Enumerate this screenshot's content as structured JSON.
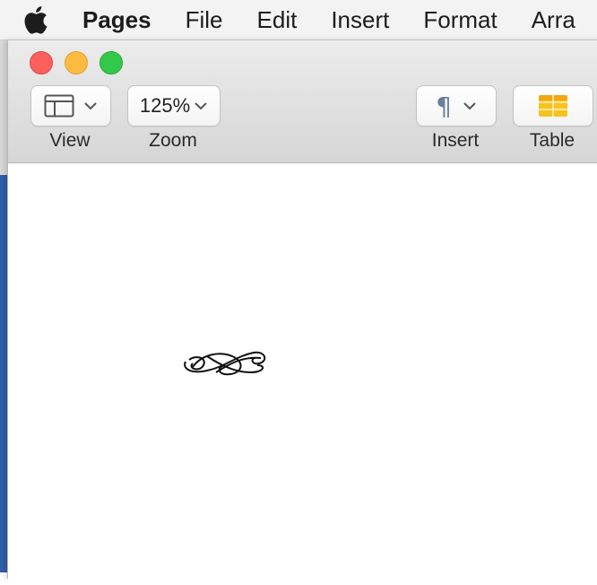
{
  "menubar": {
    "apple_icon": "apple-logo",
    "items": [
      "Pages",
      "File",
      "Edit",
      "Insert",
      "Format",
      "Arra"
    ]
  },
  "toolbar": {
    "view": {
      "label": "View",
      "icon": "sidebar-layout-icon"
    },
    "zoom": {
      "label": "Zoom",
      "value": "125%"
    },
    "insert": {
      "label": "Insert",
      "icon": "pilcrow-icon",
      "glyph": "¶"
    },
    "table": {
      "label": "Table",
      "icon": "table-icon"
    }
  },
  "colors": {
    "close": "#fc605c",
    "minimize": "#fdbc40",
    "zoom": "#34c84a",
    "table_icon": "#f7c31e"
  }
}
